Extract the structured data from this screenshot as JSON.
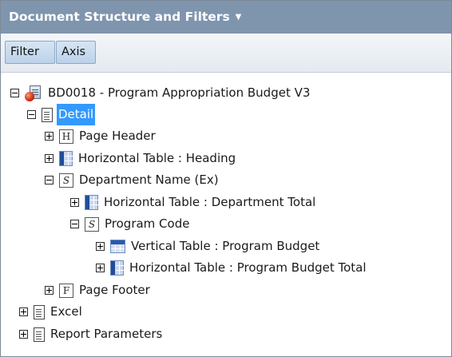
{
  "panel": {
    "title": "Document Structure and Filters",
    "title_caret_icon": "chevron-down-icon"
  },
  "toolbar": {
    "filter_label": "Filter",
    "axis_label": "Axis"
  },
  "tree": {
    "root": {
      "label": "BD0018 - Program Appropriation Budget V3",
      "icon": "report-icon",
      "expanded": true
    },
    "detail": {
      "label": "Detail",
      "icon": "document-icon",
      "expanded": true,
      "selected": true
    },
    "page_header": {
      "label": "Page Header",
      "icon": "header-section-icon",
      "icon_letter": "H",
      "expanded": false
    },
    "h_table_heading": {
      "label": "Horizontal Table : Heading",
      "icon": "horizontal-table-icon",
      "expanded": false
    },
    "department_name": {
      "label": "Department Name (Ex)",
      "icon": "section-icon",
      "icon_letter": "S",
      "expanded": true
    },
    "h_table_dept_total": {
      "label": "Horizontal Table : Department Total",
      "icon": "horizontal-table-icon",
      "expanded": false
    },
    "program_code": {
      "label": "Program Code",
      "icon": "section-icon",
      "icon_letter": "S",
      "expanded": true
    },
    "v_table_program_budget": {
      "label": "Vertical Table : Program Budget",
      "icon": "vertical-table-icon",
      "expanded": false
    },
    "h_table_program_budget_total": {
      "label": "Horizontal Table : Program Budget Total",
      "icon": "horizontal-table-icon",
      "expanded": false
    },
    "page_footer": {
      "label": "Page Footer",
      "icon": "footer-section-icon",
      "icon_letter": "F",
      "expanded": false
    },
    "excel": {
      "label": "Excel",
      "icon": "document-icon",
      "expanded": false
    },
    "report_parameters": {
      "label": "Report Parameters",
      "icon": "document-icon",
      "expanded": false
    }
  }
}
